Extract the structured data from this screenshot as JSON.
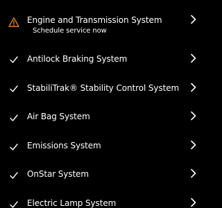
{
  "colors": {
    "background": "#000000",
    "text": "#ffffff",
    "warning": "#e8893a",
    "check": "#ffffff"
  },
  "items": [
    {
      "title": "Engine and Transmission System",
      "subtitle": "Schedule service now",
      "status_icon": "warning-triangle-icon"
    },
    {
      "title": "Antilock Braking System",
      "status_icon": "check-icon"
    },
    {
      "title": "StabiliTrak® Stability Control System",
      "status_icon": "check-icon"
    },
    {
      "title": "Air Bag System",
      "status_icon": "check-icon"
    },
    {
      "title": "Emissions System",
      "status_icon": "check-icon"
    },
    {
      "title": "OnStar System",
      "status_icon": "check-icon"
    },
    {
      "title": "Electric Lamp System",
      "status_icon": "check-icon"
    }
  ]
}
